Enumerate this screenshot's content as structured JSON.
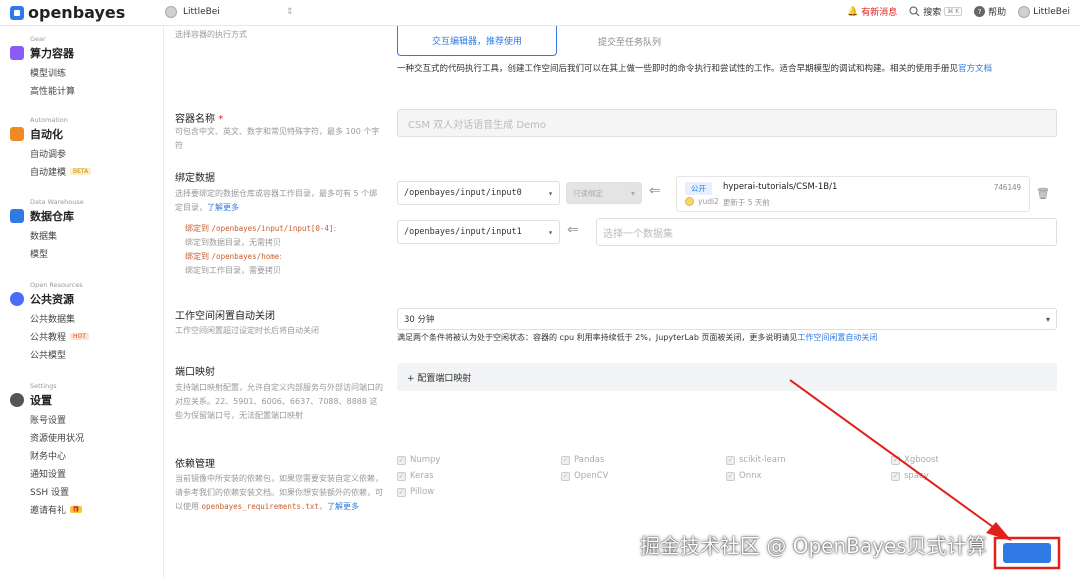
{
  "topbar": {
    "logo_text": "openbayes",
    "org_name": "LittleBei",
    "news_label": "有新消息",
    "search_label": "搜索",
    "search_shortcut": "⌘ K",
    "help_label": "帮助",
    "user_name": "LittleBei"
  },
  "sidebar": {
    "sections": [
      {
        "en": "Gear",
        "title": "算力容器",
        "items": [
          "模型训练",
          "高性能计算"
        ]
      },
      {
        "en": "Automation",
        "title": "自动化",
        "items": [
          "自动调参",
          "自动建模"
        ],
        "badge": "BETA"
      },
      {
        "en": "Data Warehouse",
        "title": "数据仓库",
        "items": [
          "数据集",
          "模型"
        ]
      },
      {
        "en": "Open Resources",
        "title": "公共资源",
        "items": [
          "公共数据集",
          "公共教程",
          "公共模型"
        ],
        "badge": "HOT"
      },
      {
        "en": "Settings",
        "title": "设置",
        "items": [
          "账号设置",
          "资源使用状况",
          "财务中心",
          "通知设置",
          "SSH 设置",
          "邀请有礼"
        ]
      }
    ]
  },
  "form": {
    "exec_desc": "选择容器的执行方式",
    "interactive_label": "交互编辑器，推荐使用",
    "task_label": "提交至任务队列",
    "interactive_note": "一种交互式的代码执行工具，创建工作空间后我们可以在其上做一些即时的命令执行和尝试性的工作。适合早期模型的调试和构建。相关的使用手册见",
    "interactive_note_link": "官方文档",
    "name_label": "容器名称",
    "name_required": "*",
    "name_desc": "可包含中文、英文、数字和常见特殊字符，最多 100 个字符",
    "name_value": "CSM 双人对话语音生成 Demo",
    "bind_label": "绑定数据",
    "bind_desc": "选择要绑定的数据仓库或容器工作目录，最多可有 5 个绑定目录，",
    "bind_more": "了解更多",
    "bind_to": "绑定到",
    "bind_path1": "/openbayes/input/input[0-4]",
    "bind_note1": "绑定到数据目录，无需拷贝",
    "bind_path2": "/openbayes/home",
    "bind_note2": "绑定到工作目录，需要拷贝",
    "mount1": "/openbayes/input/input0",
    "mode1": "只读绑定",
    "dataset_public": "公开",
    "dataset_name": "hyperai-tutorials/CSM-1B/1",
    "dataset_size": "746149",
    "dataset_user": "yudi2",
    "dataset_updated": "更新于 5 天前",
    "mount2": "/openbayes/input/input1",
    "dataset_placeholder": "选择一个数据集",
    "idle_label": "工作空间闲置自动关闭",
    "idle_desc": "工作空间闲置超过设定时长后将自动关闭",
    "idle_value": "30 分钟",
    "idle_note": "满足两个条件将被认为处于空闲状态：容器的 cpu 利用率持续低于 2%，JupyterLab 页面被关闭，更多说明请见",
    "idle_link": "工作空间闲置自动关闭",
    "port_label": "端口映射",
    "port_desc": "支持端口映射配置，允许自定义内部服务与外部访问端口的对应关系。22、5901、6006、6637、7088、8888 这些为保留端口号，无法配置端口映射",
    "port_button": "+ 配置端口映射",
    "deps_label": "依赖管理",
    "deps_desc": "当前镜像中所安装的依赖包，如果您需要安装自定义依赖，请参考我们的依赖安装文档。如果你想安装额外的依赖，可以使用",
    "deps_file": "openbayes_requirements.txt",
    "deps_more": "了解更多",
    "deps": [
      [
        "Numpy",
        "Pandas",
        "scikit-learn",
        "Xgboost"
      ],
      [
        "Keras",
        "OpenCV",
        "Onnx",
        "spacy"
      ],
      [
        "Pillow"
      ]
    ]
  },
  "watermark": "掘金技术社区 @ OpenBayes贝式计算",
  "colors": {
    "brand": "#2f7ae5",
    "annotation_red": "#e0201a"
  }
}
